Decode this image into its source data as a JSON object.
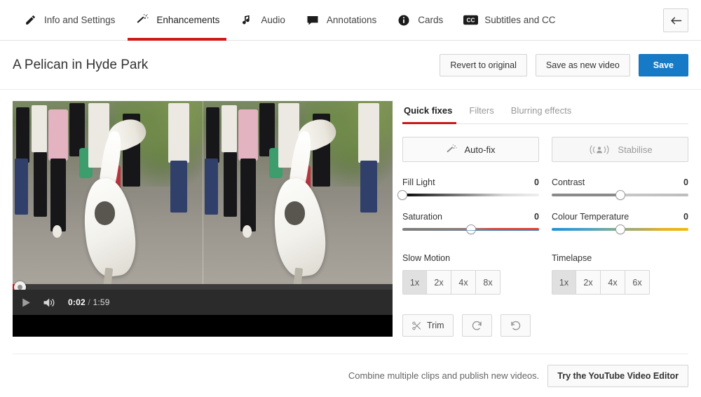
{
  "nav": {
    "tabs": [
      {
        "label": "Info and Settings",
        "icon": "pencil-icon",
        "active": false
      },
      {
        "label": "Enhancements",
        "icon": "magic-wand-icon",
        "active": true
      },
      {
        "label": "Audio",
        "icon": "music-note-icon",
        "active": false
      },
      {
        "label": "Annotations",
        "icon": "speech-bubble-icon",
        "active": false
      },
      {
        "label": "Cards",
        "icon": "info-circle-icon",
        "active": false
      },
      {
        "label": "Subtitles and CC",
        "icon": "cc-icon",
        "active": false
      }
    ],
    "back_icon": "back-arrow-icon",
    "active_underline_color": "#cc1a1a"
  },
  "header": {
    "title": "A Pelican in Hyde Park",
    "revert_label": "Revert to original",
    "save_as_new_label": "Save as new video",
    "save_label": "Save",
    "save_color": "#167ac6"
  },
  "player": {
    "play_icon": "play-icon",
    "volume_icon": "volume-icon",
    "current_time": "0:02",
    "separator": "/",
    "duration": "1:59",
    "progress_percent": 2,
    "progress_color": "#cc181e"
  },
  "panel": {
    "tabs": [
      {
        "label": "Quick fixes",
        "active": true
      },
      {
        "label": "Filters",
        "active": false
      },
      {
        "label": "Blurring effects",
        "active": false
      }
    ],
    "autofix": {
      "label": "Auto-fix",
      "icon": "magic-wand-icon",
      "disabled": false
    },
    "stabilise": {
      "label": "Stabilise",
      "icon": "stabilise-icon",
      "disabled": true
    },
    "sliders": [
      {
        "name": "Fill Light",
        "value": "0",
        "position": 0
      },
      {
        "name": "Contrast",
        "value": "0",
        "position": 50
      },
      {
        "name": "Saturation",
        "value": "0",
        "position": 50
      },
      {
        "name": "Colour Temperature",
        "value": "0",
        "position": 50
      }
    ],
    "slow_motion": {
      "label": "Slow Motion",
      "options": [
        "1x",
        "2x",
        "4x",
        "8x"
      ],
      "selected": "1x"
    },
    "timelapse": {
      "label": "Timelapse",
      "options": [
        "1x",
        "2x",
        "4x",
        "6x"
      ],
      "selected": "1x"
    },
    "tools": {
      "trim_label": "Trim",
      "trim_icon": "scissors-icon",
      "redo_icon": "redo-icon",
      "undo_icon": "undo-icon"
    }
  },
  "footer": {
    "text": "Combine multiple clips and publish new videos.",
    "button_label": "Try the YouTube Video Editor"
  }
}
